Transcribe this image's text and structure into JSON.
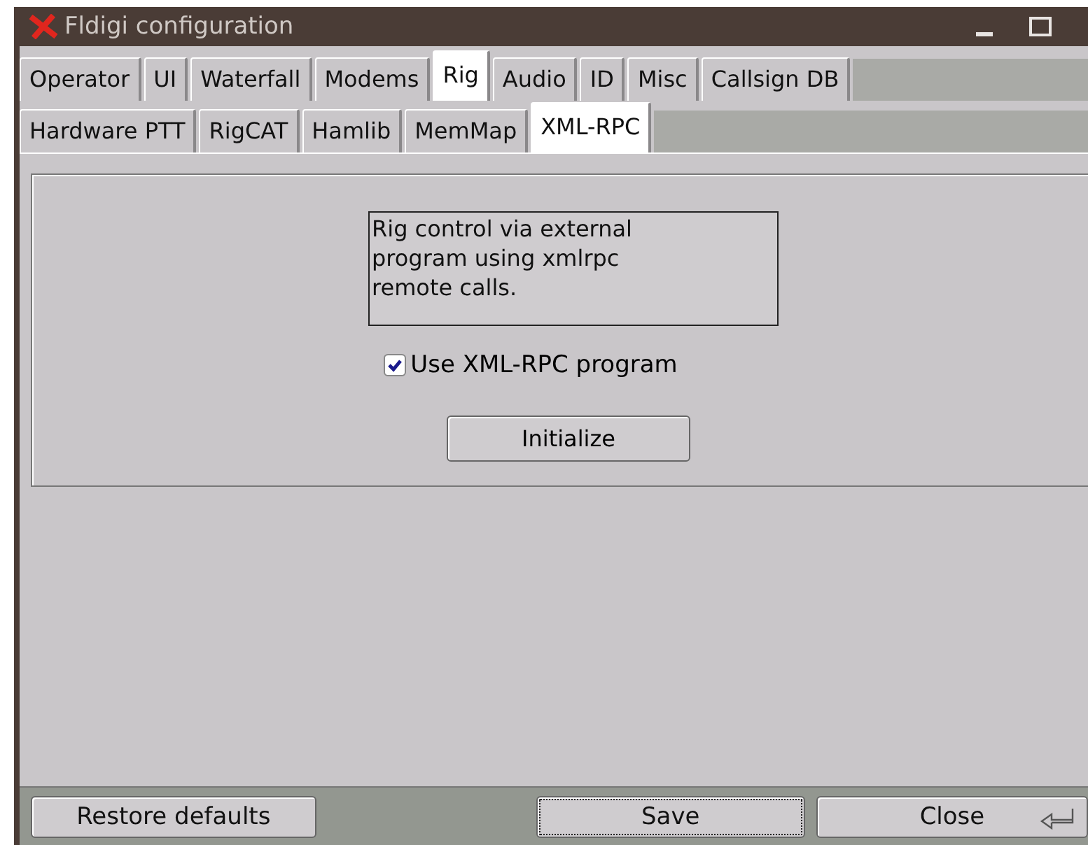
{
  "window": {
    "title": "Fldigi configuration"
  },
  "tabs": [
    {
      "label": "Operator",
      "selected": false
    },
    {
      "label": "UI",
      "selected": false
    },
    {
      "label": "Waterfall",
      "selected": false
    },
    {
      "label": "Modems",
      "selected": false
    },
    {
      "label": "Rig",
      "selected": true
    },
    {
      "label": "Audio",
      "selected": false
    },
    {
      "label": "ID",
      "selected": false
    },
    {
      "label": "Misc",
      "selected": false
    },
    {
      "label": "Callsign DB",
      "selected": false
    }
  ],
  "subtabs": [
    {
      "label": "Hardware PTT",
      "selected": false
    },
    {
      "label": "RigCAT",
      "selected": false
    },
    {
      "label": "Hamlib",
      "selected": false
    },
    {
      "label": "MemMap",
      "selected": false
    },
    {
      "label": "XML-RPC",
      "selected": true
    }
  ],
  "description": "Rig control via external program using xmlrpc remote calls.",
  "use_xmlrpc": {
    "label": "Use XML-RPC program",
    "checked": true
  },
  "initialize_button": "Initialize",
  "buttons": [
    {
      "label": "Restore defaults",
      "focused": false,
      "kind": "plain"
    },
    {
      "label": "Save",
      "focused": true,
      "kind": "plain"
    },
    {
      "label": "Close",
      "focused": false,
      "kind": "return"
    }
  ]
}
